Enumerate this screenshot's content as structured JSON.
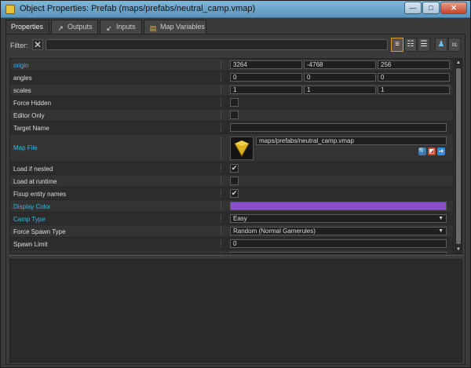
{
  "window": {
    "title": "Object Properties: Prefab (maps/prefabs/neutral_camp.vmap)",
    "minimize": "—",
    "maximize": "□",
    "close": "✕"
  },
  "tabs": [
    {
      "label": "Properties",
      "icon": ""
    },
    {
      "label": "Outputs",
      "icon": "outputs-arrow-icon"
    },
    {
      "label": "Inputs",
      "icon": "inputs-arrow-icon"
    },
    {
      "label": "Map Variables",
      "icon": "map-variables-icon"
    }
  ],
  "filter": {
    "label": "Filter:",
    "value": "",
    "clear_icon": "close-icon"
  },
  "toolbar_icons": [
    "list-view-icon",
    "grouped-view-icon",
    "detail-view-icon",
    "pick-entity-icon",
    "binary-view-icon"
  ],
  "properties": {
    "origin": {
      "label": "origin",
      "values": [
        "3264",
        "-4768",
        "256"
      ]
    },
    "angles": {
      "label": "angles",
      "values": [
        "0",
        "0",
        "0"
      ]
    },
    "scales": {
      "label": "scales",
      "values": [
        "1",
        "1",
        "1"
      ]
    },
    "force_hidden": {
      "label": "Force Hidden",
      "checked": false
    },
    "editor_only": {
      "label": "Editor Only",
      "checked": false
    },
    "target_name": {
      "label": "Target Name",
      "value": ""
    },
    "map_file": {
      "label": "Map File",
      "value": "maps/prefabs/neutral_camp.vmap"
    },
    "load_if_nested": {
      "label": "Load if nested",
      "checked": true,
      "mark": "✔"
    },
    "load_at_runtime": {
      "label": "Load at runtime",
      "checked": false
    },
    "fixup_entity_names": {
      "label": "Fixup entity names",
      "checked": true,
      "mark": "✔"
    },
    "display_color": {
      "label": "Display Color",
      "color": "#8a4fc2"
    },
    "camp_type": {
      "label": "Camp Type",
      "value": "Easy"
    },
    "force_spawn_type": {
      "label": "Force Spawn Type",
      "value": "Random (Normal Gamerules)"
    },
    "spawn_limit": {
      "label": "Spawn Limit",
      "value": "0"
    }
  },
  "colors": {
    "accent_blue": "#39b7e6",
    "selected_tool": "#d89a33"
  }
}
